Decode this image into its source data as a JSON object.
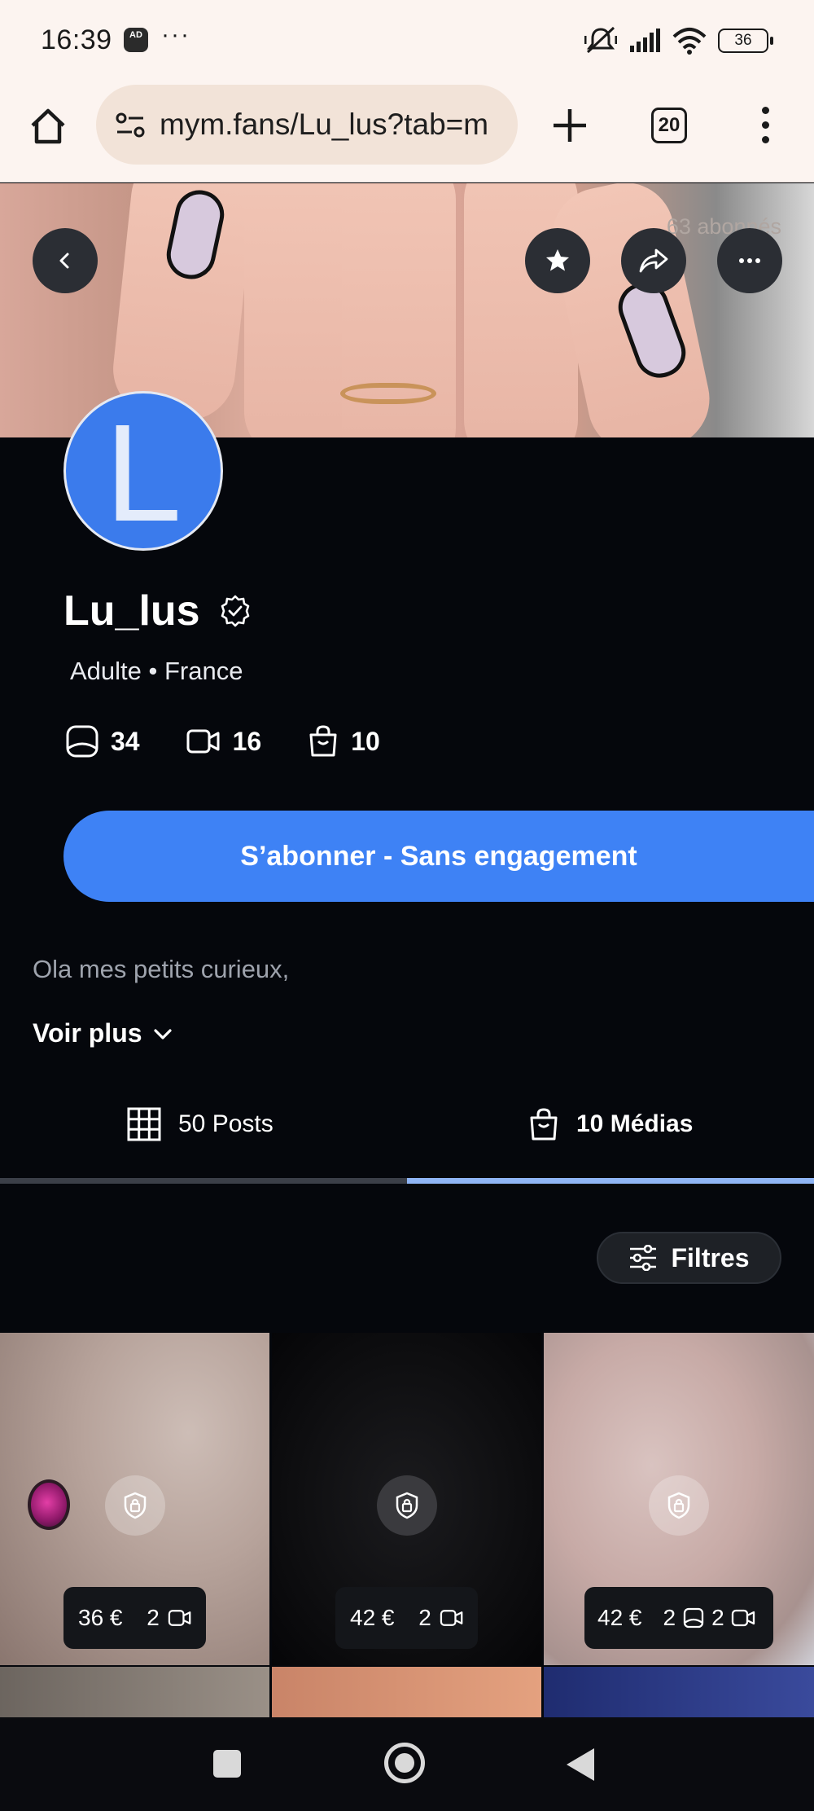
{
  "status_bar": {
    "time": "16:39",
    "ad_badge": "AD",
    "more": "···",
    "battery": "36"
  },
  "browser": {
    "url": "mym.fans/Lu_lus?tab=m",
    "tab_count": "20"
  },
  "cover": {
    "subscribers": "63 abonnés"
  },
  "profile": {
    "avatar_letter": "L",
    "name": "Lu_lus",
    "meta": "Adulte • France",
    "stats": {
      "photos": "34",
      "videos": "16",
      "media": "10"
    },
    "subscribe_label": "S’abonner - Sans engagement",
    "bio": "Ola mes petits curieux,",
    "see_more": "Voir plus"
  },
  "tabs": {
    "posts": "50 Posts",
    "media": "10 Médias",
    "active": "media"
  },
  "filters_label": "Filtres",
  "media_items": [
    {
      "price": "36 €",
      "videos": "2"
    },
    {
      "price": "42 €",
      "videos": "2"
    },
    {
      "price": "42 €",
      "photos": "2",
      "videos": "2"
    }
  ],
  "colors": {
    "accent": "#3e82f5",
    "background": "#05070c",
    "tab_active": "#8fb5f5"
  }
}
